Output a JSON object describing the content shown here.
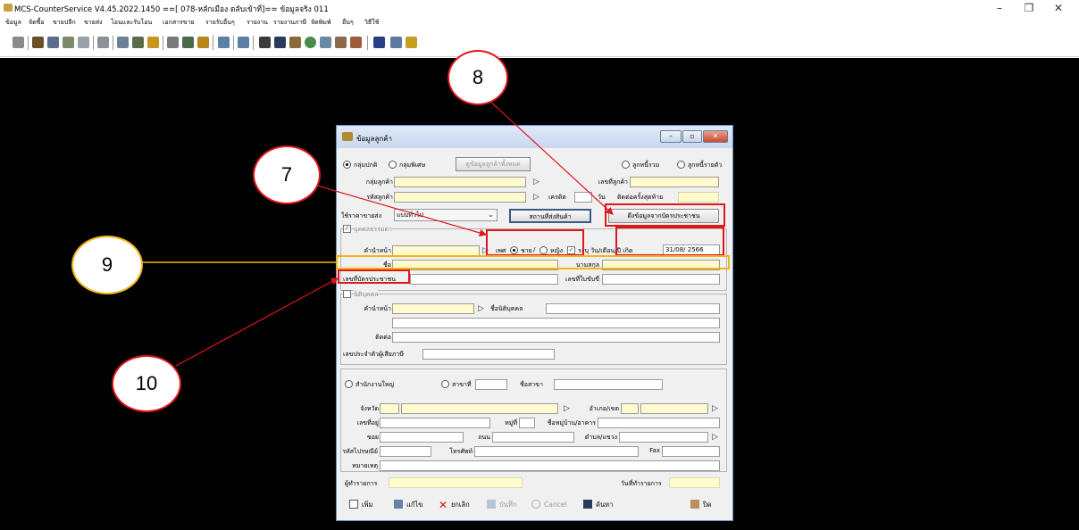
{
  "window": {
    "title": "MCS-CounterService V4.45.2022.1450 ==[ 078-หลักเมือง ตลับเข้าที่]== ข้อมูลจริง 011",
    "minimize_label": "–",
    "maximize_label": "❐",
    "close_label": "✕"
  },
  "menu": [
    "ข้อมูล",
    "จัดซื้อ",
    "ขายปลีก",
    "ขายส่ง",
    "โอนและรับโอน",
    "เอกสารขาย",
    "รายรับอื่นๆ",
    "รายงาน",
    "รายงานภาษี",
    "จัดพิมพ์",
    "อื่นๆ",
    "วิธีใช้"
  ],
  "toolbar_icons": [
    "search-icon",
    "report-icon",
    "sheet-icon",
    "chart-icon",
    "grid-icon",
    "doc-icon",
    "receipt-icon",
    "list-icon",
    "money-icon",
    "percent-icon",
    "stock-icon",
    "money-bag-icon",
    "print-icon",
    "print2-icon",
    "customer-icon",
    "binoculars-icon",
    "car-icon",
    "record-icon",
    "calc-icon",
    "book-icon",
    "gear-icon",
    "bookmark-icon",
    "printer-icon",
    "lock-icon"
  ],
  "dialog": {
    "title": "ข้อมูลลูกค้า",
    "group_normal": "กลุ่มปกติ",
    "group_special": "กลุ่มพิเศษ",
    "show_all_button": "ดูข้อมูลลูกค้าทั้งหมด",
    "debtor_all": "ลูกหนี้รวม",
    "debtor_each": "ลูกหนี้รายตัว",
    "customer_group_label": "กลุ่มลูกค้า",
    "customer_code_label": "รหัสลูกค้า",
    "customer_no_label": "เลขที่ลูกค้า",
    "credit_label": "เครดิต",
    "days_label": "วัน",
    "last_contact_label": "ติดต่อครั้งสุดท้าย",
    "price_type_label": "ใช้ราคาขายส่ง",
    "price_type_value": "แบบทั่วไป",
    "shipping_button": "สถานที่ส่งสินค้า",
    "fetch_id_button": "ดึงข้อมูลจากบัตรประชาชน",
    "person_section": "บุคคลธรรมดา",
    "prefix_label": "คำนำหน้า",
    "sex_label": "เพศ",
    "male_label": "ชาย",
    "female_label": "หญิง",
    "birth_label": "ระบุ วัน/เดือน/ปี เกิด",
    "birth_value": "31/08/ 2566",
    "first_name_label": "ชื่อ",
    "last_name_label": "นามสกุล",
    "id_card_label": "เลขที่บัตรประชาชน",
    "account_no_label": "เลขที่ใบขับขี่",
    "juristic_section": "นิติบุคคล",
    "juristic_prefix_label": "คำนำหน้า",
    "juristic_name_label": "ชื่อนิติบุคคล",
    "contact_label": "ติดต่อ",
    "tax_id_label": "เลขประจำตัวผู้เสียภาษี",
    "head_office_label": "สำนักงานใหญ่",
    "branch_label": "สาขาที่",
    "branch_name_label": "ชื่อสาขา",
    "province_label": "จังหวัด",
    "district_label": "อำเภอ/เขต",
    "address_no_label": "เลขที่อยู่",
    "moo_label": "หมู่ที่",
    "village_label": "ชื่อหมู่บ้าน/อาคาร",
    "soi_label": "ซอย",
    "road_label": "ถนน",
    "subdistrict_label": "ตำบล/แขวง",
    "postcode_label": "รหัสไปรษณีย์",
    "phone_label": "โทรศัพท์",
    "fax_label": "Fax",
    "note_label": "หมายเหตุ",
    "operator_label": "ผู้ทำรายการ",
    "date_label": "วันที่ทำรายการ",
    "buttons": {
      "add": "เพิ่ม",
      "edit": "แก้ไข",
      "cancel_entry": "ยกเลิก",
      "save": "บันทึก",
      "cancel": "Cancel",
      "search": "ค้นหา",
      "close": "ปิด"
    }
  },
  "annotations": {
    "n7": "7",
    "n8": "8",
    "n9": "9",
    "n10": "10",
    "red": "#e0161c",
    "yellow": "#f2b416"
  }
}
